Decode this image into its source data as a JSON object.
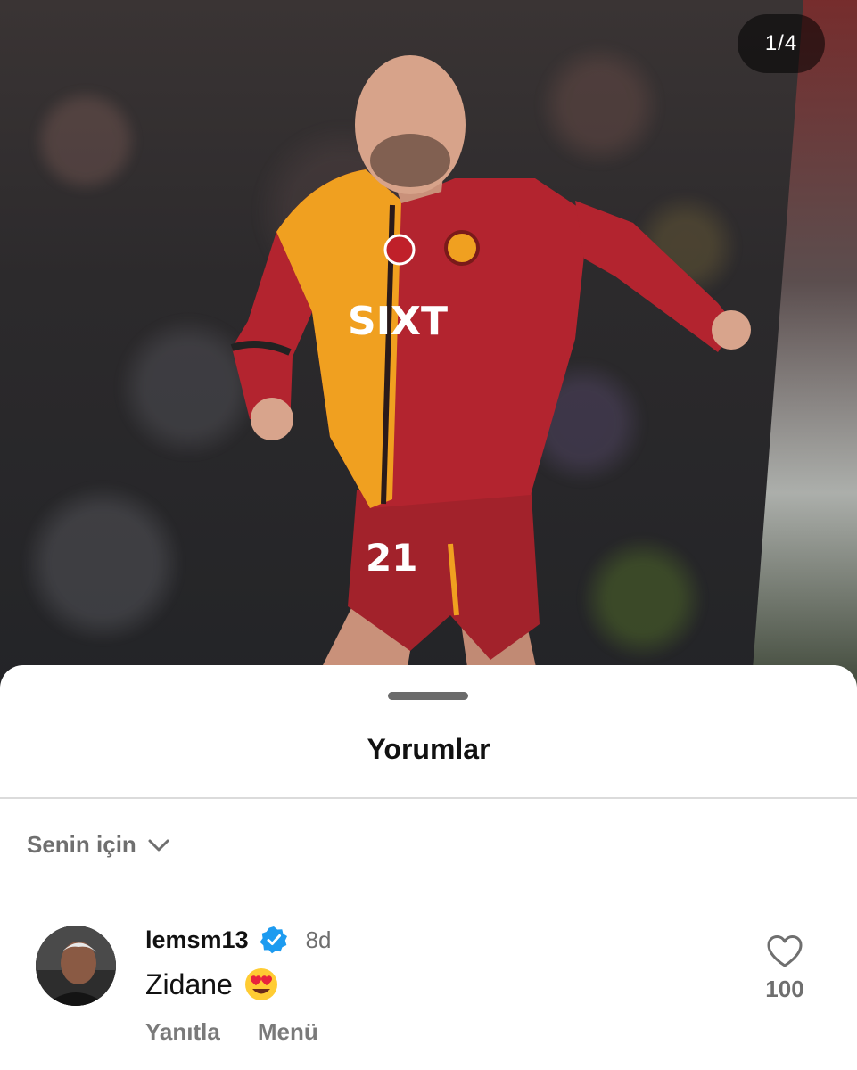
{
  "post": {
    "pager": "1/4",
    "shirt_sponsor": "SIXT",
    "shirt_number": "21"
  },
  "sheet": {
    "title": "Yorumlar",
    "filter_label": "Senin için"
  },
  "comments": [
    {
      "username": "lemsm13",
      "verified": true,
      "time": "8d",
      "text": "Zidane",
      "emoji": "heart-eyes",
      "reply_label": "Yanıtla",
      "menu_label": "Menü",
      "like_count": "100"
    }
  ],
  "icons": {
    "filter_chevron": "chevron-down-icon",
    "verified_badge": "verified-badge-icon",
    "like": "heart-outline-icon"
  },
  "colors": {
    "verified_blue": "#1d9bf0",
    "shirt_red": "#b3242f",
    "shirt_yellow": "#f0a020",
    "secondary_text": "#6f6f6f"
  }
}
